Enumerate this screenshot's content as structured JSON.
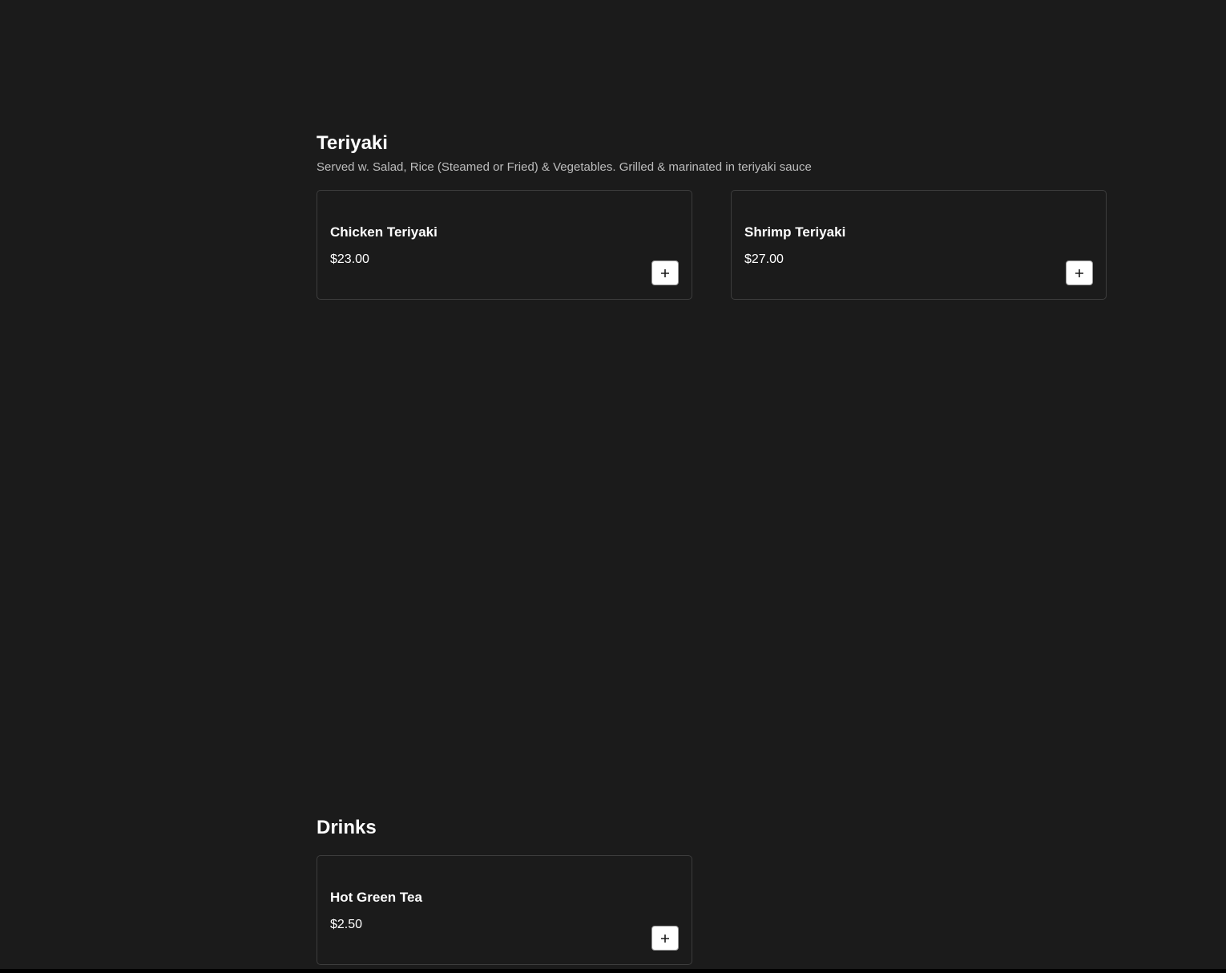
{
  "sections": [
    {
      "title": "Teriyaki",
      "description": "Served w. Salad, Rice (Steamed or Fried) & Vegetables. Grilled & marinated in teriyaki sauce",
      "items": [
        {
          "name": "Chicken Teriyaki",
          "price": "$23.00",
          "add_icon": "plus-icon"
        },
        {
          "name": "Shrimp Teriyaki",
          "price": "$27.00",
          "add_icon": "plus-icon"
        }
      ]
    },
    {
      "title": "Drinks",
      "items": [
        {
          "name": "Hot Green Tea",
          "price": "$2.50",
          "add_icon": "plus-icon"
        }
      ]
    }
  ],
  "colors": {
    "background": "#1b1b1b",
    "card_border": "#3d3d3d",
    "text_primary": "#ffffff",
    "text_secondary": "#bdbdbd",
    "button_background": "#ffffff"
  }
}
